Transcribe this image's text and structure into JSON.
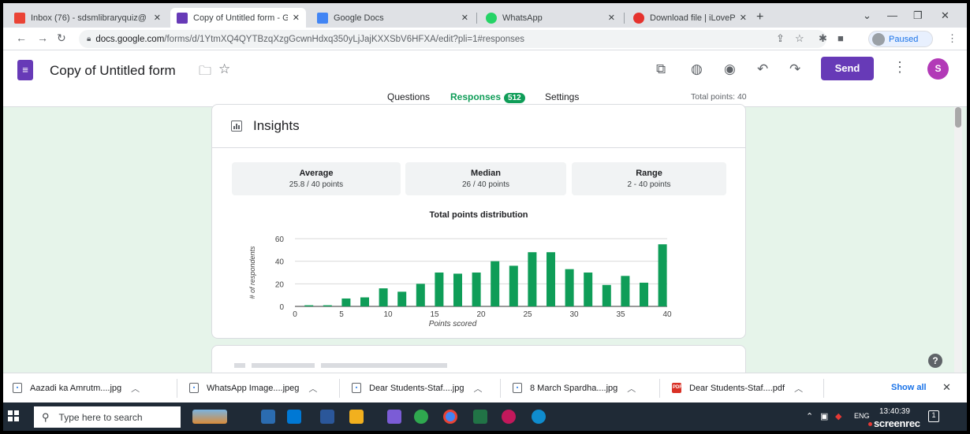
{
  "browser": {
    "tabs": [
      {
        "title": "Inbox (76) - sdsmlibraryquiz@",
        "color": "#ea4335"
      },
      {
        "title": "Copy of Untitled form - Goog",
        "color": "#673ab7"
      },
      {
        "title": "Google Docs",
        "color": "#4285f4"
      },
      {
        "title": "WhatsApp",
        "color": "#25d366"
      },
      {
        "title": "Download file | iLovePDF",
        "color": "#e5322d"
      }
    ],
    "url_host": "docs.google.com",
    "url_path": "/forms/d/1YtmXQ4QYTBzqXzgGcwnHdxq350yLjJajKXXSbV6HFXA/edit?pli=1#responses",
    "profile_status": "Paused"
  },
  "form": {
    "title": "Copy of Untitled form",
    "send_label": "Send",
    "avatar_initial": "S",
    "tabs": {
      "questions": "Questions",
      "responses": "Responses",
      "responses_count": "512",
      "settings": "Settings"
    },
    "total_points": "Total points: 40"
  },
  "insights": {
    "title": "Insights",
    "stats": [
      {
        "label": "Average",
        "value": "25.8 / 40 points"
      },
      {
        "label": "Median",
        "value": "26 / 40 points"
      },
      {
        "label": "Range",
        "value": "2 - 40 points"
      }
    ]
  },
  "chart_data": {
    "type": "bar",
    "title": "Total points distribution",
    "xlabel": "Points scored",
    "ylabel": "# of respondents",
    "xlim": [
      0,
      40
    ],
    "ylim": [
      0,
      60
    ],
    "xticks": [
      0,
      5,
      10,
      15,
      20,
      25,
      30,
      35,
      40
    ],
    "yticks": [
      0,
      20,
      40,
      60
    ],
    "grid": true,
    "color": "#0f9d58",
    "x": [
      2,
      4,
      6,
      8,
      10,
      12,
      14,
      16,
      18,
      20,
      22,
      24,
      26,
      28,
      30,
      32,
      34,
      36,
      38,
      40
    ],
    "values": [
      1,
      1,
      7,
      8,
      16,
      13,
      20,
      30,
      29,
      30,
      40,
      36,
      48,
      48,
      33,
      30,
      19,
      27,
      21,
      55
    ]
  },
  "downloads": {
    "items": [
      {
        "name": "Aazadi ka Amrutm....jpg",
        "type": "img"
      },
      {
        "name": "WhatsApp Image....jpeg",
        "type": "img"
      },
      {
        "name": "Dear Students-Staf....jpg",
        "type": "img"
      },
      {
        "name": "8 March Spardha....jpg",
        "type": "img"
      },
      {
        "name": "Dear Students-Staf....pdf",
        "type": "pdf"
      }
    ],
    "show_all": "Show all"
  },
  "taskbar": {
    "search_placeholder": "Type here to search",
    "time": "13:40:39",
    "lang": "ENG",
    "recorder_brand": "screenrec"
  }
}
